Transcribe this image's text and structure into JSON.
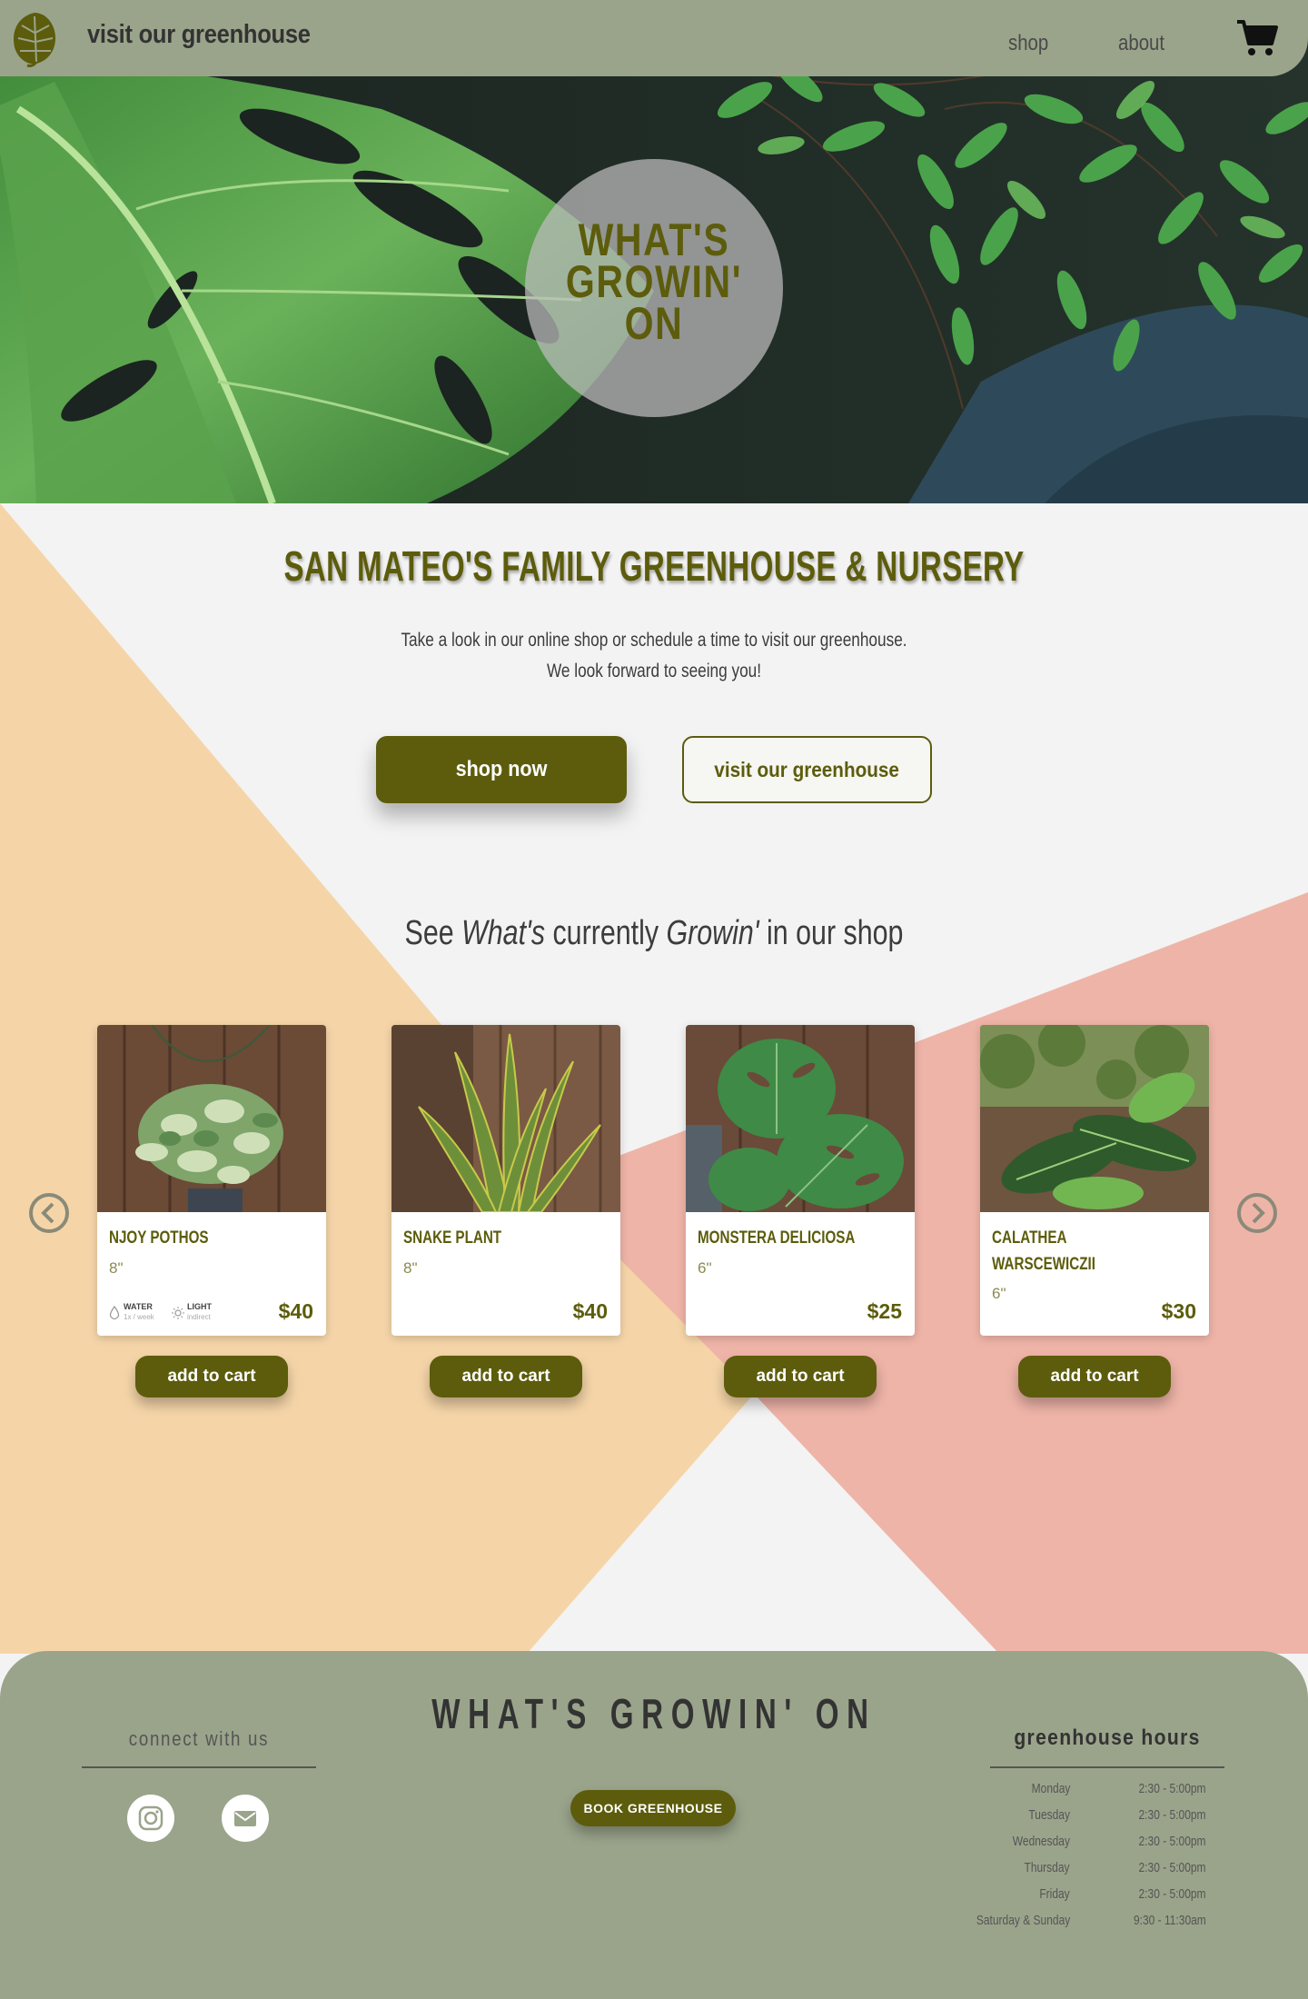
{
  "nav": {
    "title": "visit our greenhouse",
    "links": [
      "shop",
      "about"
    ]
  },
  "hero": {
    "badge_lines": [
      "WHAT'S",
      "GROWIN'",
      "ON"
    ]
  },
  "intro": {
    "headline": "SAN MATEO'S FAMILY GREENHOUSE & NURSERY",
    "lines": [
      "Take a look in our online shop or schedule a time to visit our greenhouse.",
      "We look forward to seeing you!"
    ],
    "shop_now": "shop now",
    "visit": "visit our greenhouse"
  },
  "shop": {
    "heading_parts": [
      "See ",
      "What's",
      " currently ",
      "Growin'",
      " in our shop"
    ],
    "products": [
      {
        "name": "NJOY POTHOS",
        "size": "8\"",
        "price": "$40",
        "care": {
          "water_label": "WATER",
          "water_value": "1x / week",
          "light_label": "LIGHT",
          "light_value": "indirect"
        }
      },
      {
        "name": "SNAKE PLANT",
        "size": "8\"",
        "price": "$40"
      },
      {
        "name": "MONSTERA DELICIOSA",
        "size": "6\"",
        "price": "$25"
      },
      {
        "name": "CALATHEA WARSCEWICZII",
        "size": "6\"",
        "price": "$30"
      }
    ],
    "add_to_cart": "add to cart"
  },
  "footer": {
    "connect": "connect with us",
    "brand": "WHAT'S GROWIN' ON",
    "book": "BOOK GREENHOUSE",
    "hours_title": "greenhouse hours",
    "hours": [
      {
        "day": "Monday",
        "time": "2:30 - 5:00pm"
      },
      {
        "day": "Tuesday",
        "time": "2:30 - 5:00pm"
      },
      {
        "day": "Wednesday",
        "time": "2:30 - 5:00pm"
      },
      {
        "day": "Thursday",
        "time": "2:30 - 5:00pm"
      },
      {
        "day": "Friday",
        "time": "2:30 - 5:00pm"
      },
      {
        "day": "Saturday & Sunday",
        "time": "9:30 - 11:30am"
      }
    ]
  },
  "colors": {
    "olive": "#5c5c0c",
    "sage": "#9aa48b",
    "peach": "#f5d5a8",
    "salmon": "#efb4a8",
    "background": "#f3f3f3"
  },
  "icons": [
    "monstera-leaf-icon",
    "cart-icon",
    "chevron-left-icon",
    "chevron-right-icon",
    "water-drop-icon",
    "sun-icon",
    "instagram-icon",
    "mail-icon"
  ]
}
